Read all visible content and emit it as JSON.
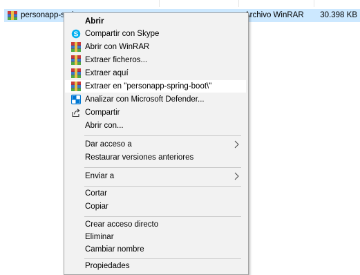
{
  "file": {
    "name": "personapp-spri",
    "type": "Archivo WinRAR",
    "size": "30.398 KB",
    "icon": "winrar-archive-icon"
  },
  "menu": {
    "items": [
      {
        "label": "Abrir",
        "icon": null,
        "bold": true
      },
      {
        "label": "Compartir con Skype",
        "icon": "skype-icon"
      },
      {
        "label": "Abrir con WinRAR",
        "icon": "winrar-icon"
      },
      {
        "label": "Extraer ficheros...",
        "icon": "winrar-icon"
      },
      {
        "label": "Extraer aquí",
        "icon": "winrar-icon"
      },
      {
        "label": "Extraer en \"personapp-spring-boot\\\"",
        "icon": "winrar-icon",
        "highlighted": true
      },
      {
        "label": "Analizar con Microsoft Defender...",
        "icon": "defender-icon"
      },
      {
        "label": "Compartir",
        "icon": "share-icon"
      },
      {
        "label": "Abrir con...",
        "icon": null
      },
      {
        "label": "Dar acceso a",
        "icon": null,
        "submenu": true
      },
      {
        "label": "Restaurar versiones anteriores",
        "icon": null
      },
      {
        "label": "Enviar a",
        "icon": null,
        "submenu": true
      },
      {
        "label": "Cortar",
        "icon": null
      },
      {
        "label": "Copiar",
        "icon": null
      },
      {
        "label": "Crear acceso directo",
        "icon": null
      },
      {
        "label": "Eliminar",
        "icon": null
      },
      {
        "label": "Cambiar nombre",
        "icon": null
      },
      {
        "label": "Propiedades",
        "icon": null
      }
    ]
  },
  "colors": {
    "selection": "#cce8ff",
    "menu_bg": "#f2f2f2",
    "skype": "#00aff0",
    "defender": "#0078d4"
  }
}
